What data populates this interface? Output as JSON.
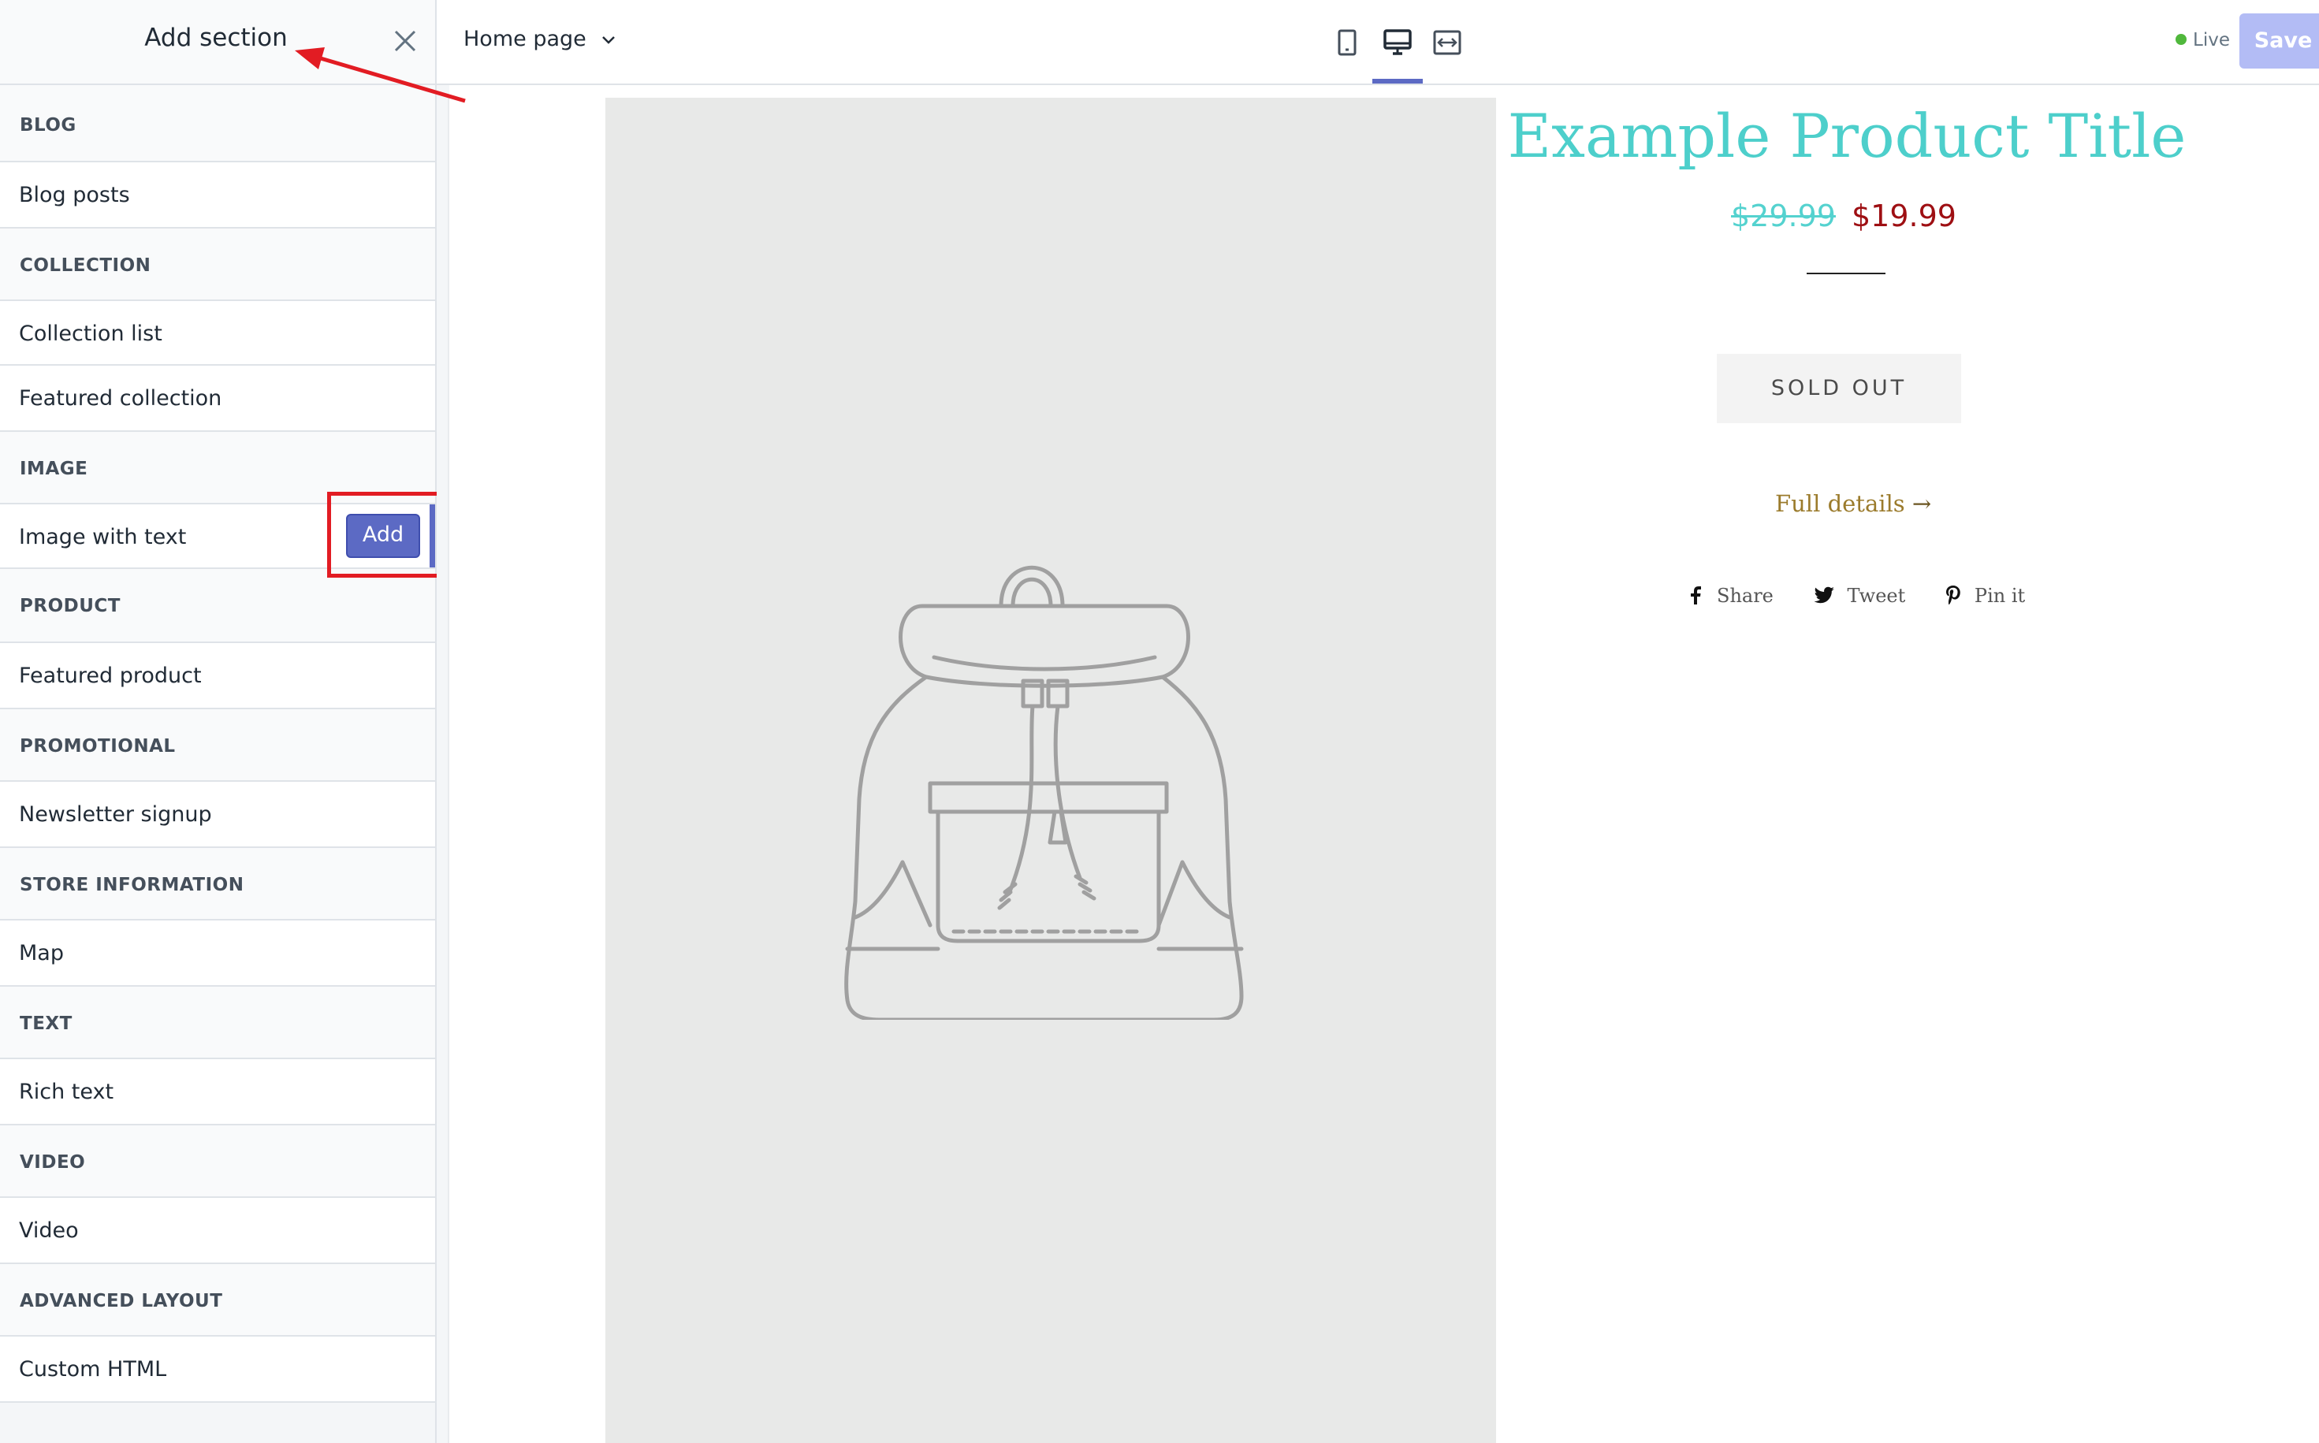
{
  "sidebar": {
    "title": "Add section",
    "groups": [
      {
        "header": "BLOG",
        "items": [
          "Blog posts"
        ]
      },
      {
        "header": "COLLECTION",
        "items": [
          "Collection list",
          "Featured collection"
        ]
      },
      {
        "header": "IMAGE",
        "items": [
          "Image with text"
        ]
      },
      {
        "header": "PRODUCT",
        "items": [
          "Featured product"
        ]
      },
      {
        "header": "PROMOTIONAL",
        "items": [
          "Newsletter signup"
        ]
      },
      {
        "header": "STORE INFORMATION",
        "items": [
          "Map"
        ]
      },
      {
        "header": "TEXT",
        "items": [
          "Rich text"
        ]
      },
      {
        "header": "VIDEO",
        "items": [
          "Video"
        ]
      },
      {
        "header": "ADVANCED LAYOUT",
        "items": [
          "Custom HTML"
        ]
      }
    ],
    "add_label": "Add"
  },
  "topbar": {
    "page_select": "Home page",
    "live_label": "Live",
    "save_label": "Save"
  },
  "preview": {
    "product_title": "Example Product Title",
    "old_price": "$29.99",
    "new_price": "$19.99",
    "sold_out": "SOLD OUT",
    "full_details": "Full details",
    "full_details_arrow": "→",
    "share": [
      "Share",
      "Tweet",
      "Pin it"
    ]
  },
  "colors": {
    "accent": "#5c6ac4",
    "title": "#4dcfcb",
    "sale_price": "#9e0f13",
    "live": "#50b83c",
    "annotation": "#e21c23"
  }
}
